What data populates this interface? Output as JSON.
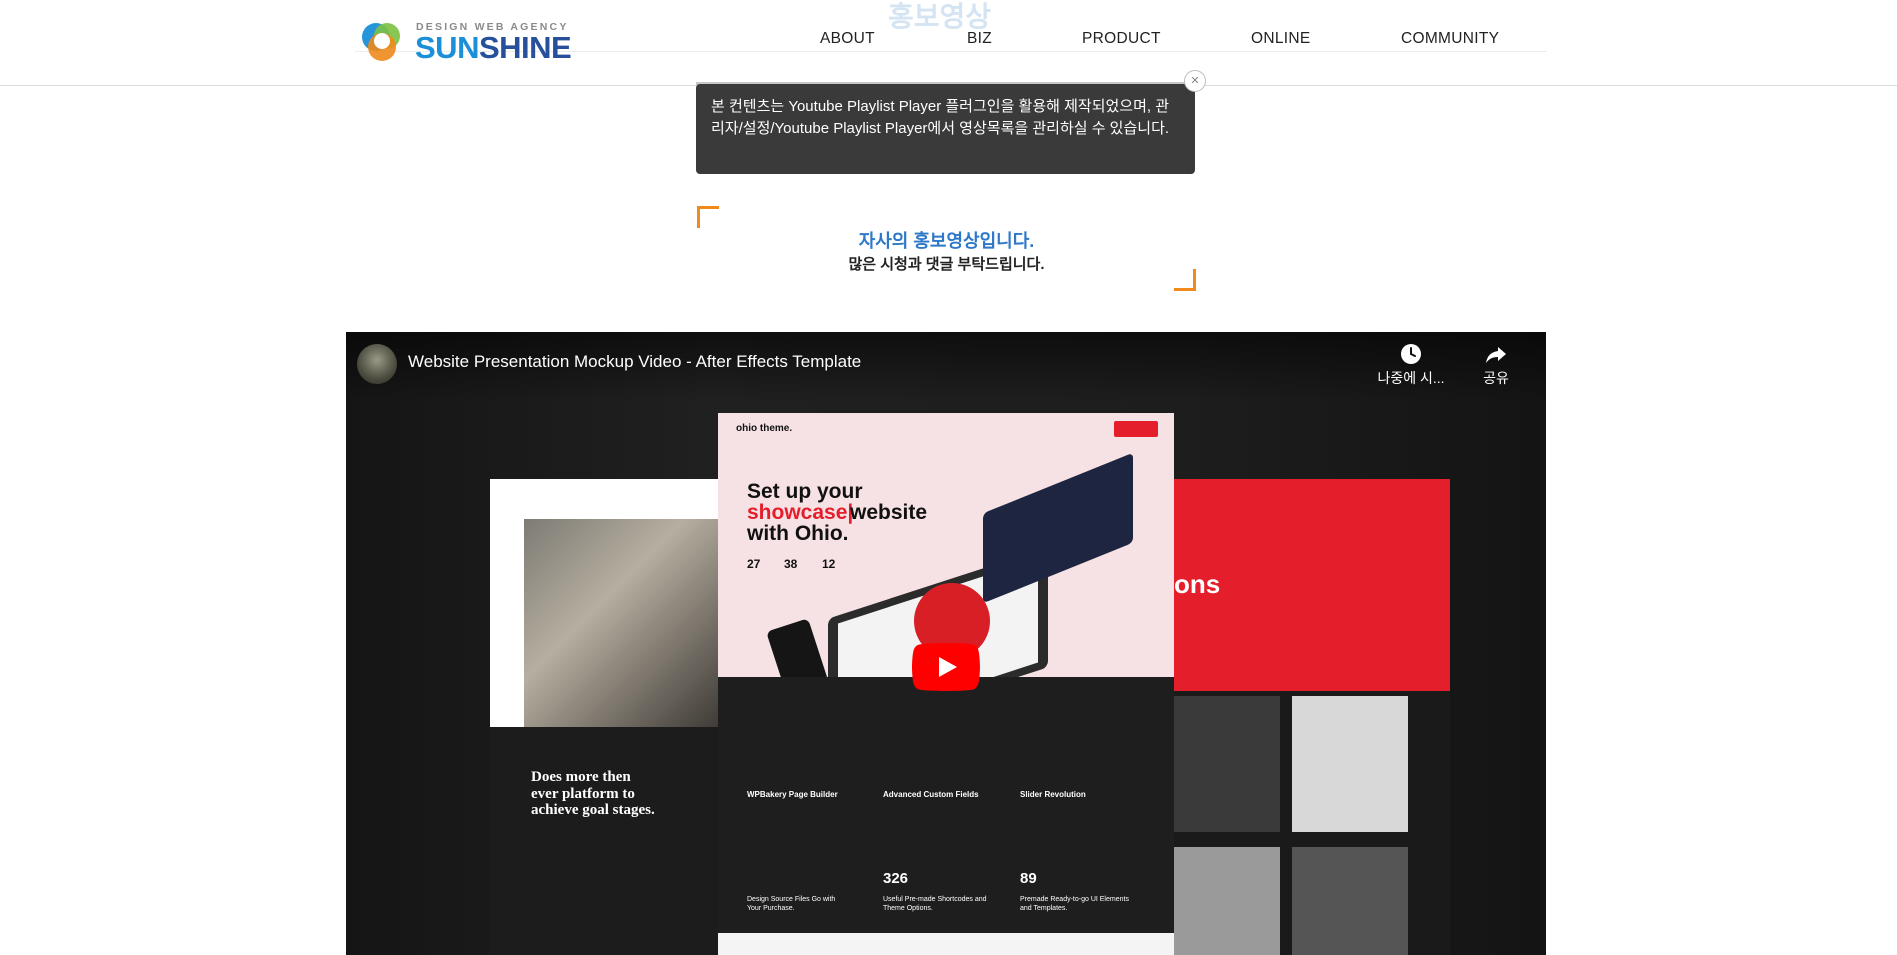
{
  "header": {
    "logo": {
      "subtitle": "DESIGN WEB AGENCY",
      "name_part1": "SUN",
      "name_part2": "SHINE"
    },
    "ghost_title": "홍보영상",
    "nav": [
      {
        "label": "ABOUT"
      },
      {
        "label": "BIZ"
      },
      {
        "label": "PRODUCT"
      },
      {
        "label": "ONLINE"
      },
      {
        "label": "COMMUNITY"
      }
    ]
  },
  "tooltip": {
    "text": "본 컨텐츠는 Youtube Playlist Player 플러그인을 활용해 제작되었으며, 관리자/설정/Youtube Playlist Player에서 영상목록을 관리하실 수 있습니다.",
    "close_icon": "x-icon"
  },
  "intro": {
    "main": "자사의 홍보영상입니다.",
    "sub": "많은 시청과 댓글 부탁드립니다."
  },
  "video": {
    "title": "Website Presentation Mockup Video - After Effects Template",
    "watch_later_label": "나중에 시...",
    "share_label": "공유",
    "mockup": {
      "center_heading_1": "Set up your",
      "center_heading_2": "showcase|",
      "center_heading_3": "website",
      "center_heading_4": "with Ohio.",
      "stats": [
        "27",
        "38",
        "12"
      ],
      "left_heading": "Does more then ever platform to achieve goal stages.",
      "right_heading": "ons",
      "feature_1": "WPBakery Page Builder",
      "feature_2": "Advanced Custom Fields",
      "feature_3": "Slider Revolution",
      "bottom_num_1": "326",
      "bottom_num_2": "89",
      "bottom_text_1": "Design Source Files Go with Your Purchase.",
      "bottom_text_2": "Useful Pre-made Shortcodes and Theme Options.",
      "bottom_text_3": "Premade Ready-to-go UI Elements and Templates.",
      "brand": "ohio theme."
    }
  },
  "colors": {
    "accent_blue": "#2d78c8",
    "accent_orange": "#f08a1c",
    "youtube_red": "#ff0000",
    "mock_red": "#e41e2b"
  }
}
